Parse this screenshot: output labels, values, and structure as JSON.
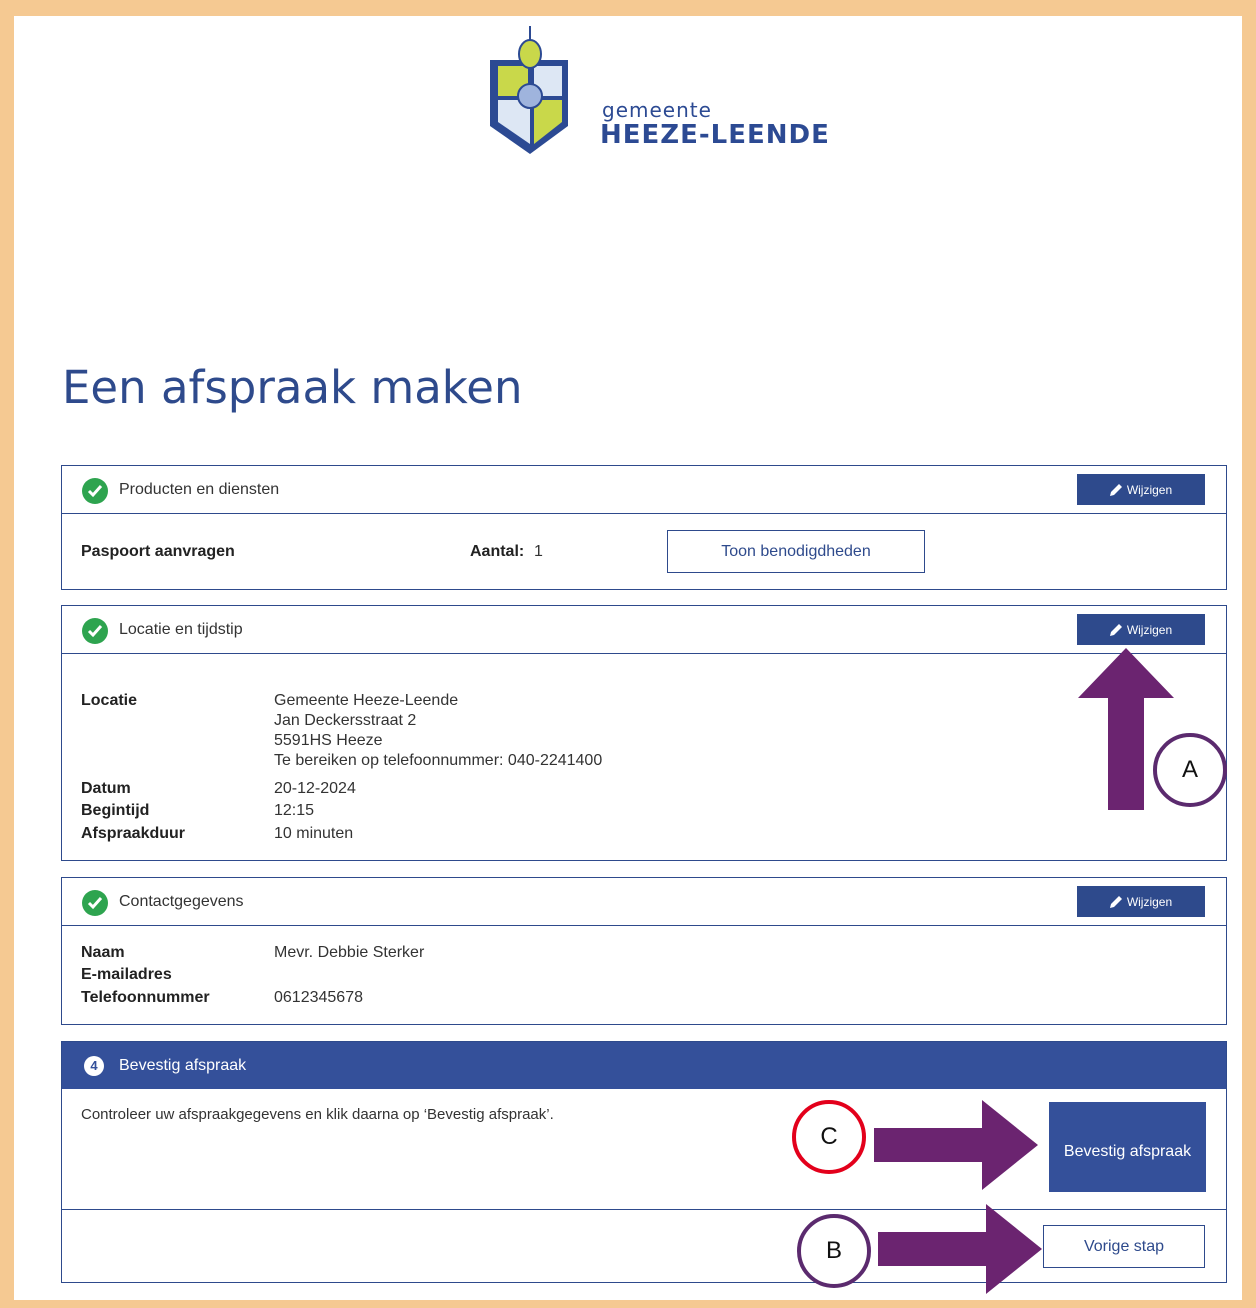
{
  "brand": {
    "line1": "gemeente",
    "line2": "HEEZE-LEENDE"
  },
  "page_title": "Een afspraak maken",
  "sections": {
    "products": {
      "title": "Producten en diensten",
      "edit_label": "Wijzigen",
      "product_name": "Paspoort aanvragen",
      "count_label": "Aantal:",
      "count_value": "1",
      "show_requirements": "Toon benodigdheden"
    },
    "location": {
      "title": "Locatie en tijdstip",
      "edit_label": "Wijzigen",
      "location_label": "Locatie",
      "address": [
        "Gemeente Heeze-Leende",
        "Jan Deckersstraat 2",
        "5591HS Heeze",
        "Te bereiken op telefoonnummer: 040-2241400"
      ],
      "date_label": "Datum",
      "date_value": "20-12-2024",
      "start_label": "Begintijd",
      "start_value": "12:15",
      "duration_label": "Afspraakduur",
      "duration_value": "10 minuten"
    },
    "contact": {
      "title": "Contactgegevens",
      "edit_label": "Wijzigen",
      "name_label": "Naam",
      "name_value": "Mevr. Debbie Sterker",
      "email_label": "E-mailadres",
      "email_value": "",
      "phone_label": "Telefoonnummer",
      "phone_value": "0612345678"
    },
    "confirm": {
      "step_number": "4",
      "title": "Bevestig afspraak",
      "instruction": "Controleer uw afspraakgegevens en klik daarna op ‘Bevestig afspraak’.",
      "confirm_button": "Bevestig afspraak",
      "previous_button": "Vorige stap"
    }
  },
  "annotations": {
    "A": "A",
    "B": "B",
    "C": "C"
  },
  "colors": {
    "primary": "#34509a",
    "check_green": "#2ea44f",
    "arrow_purple": "#6b2470",
    "circle_purple": "#5b2a6e",
    "circle_red": "#e3001b",
    "frame": "#f5c992"
  }
}
